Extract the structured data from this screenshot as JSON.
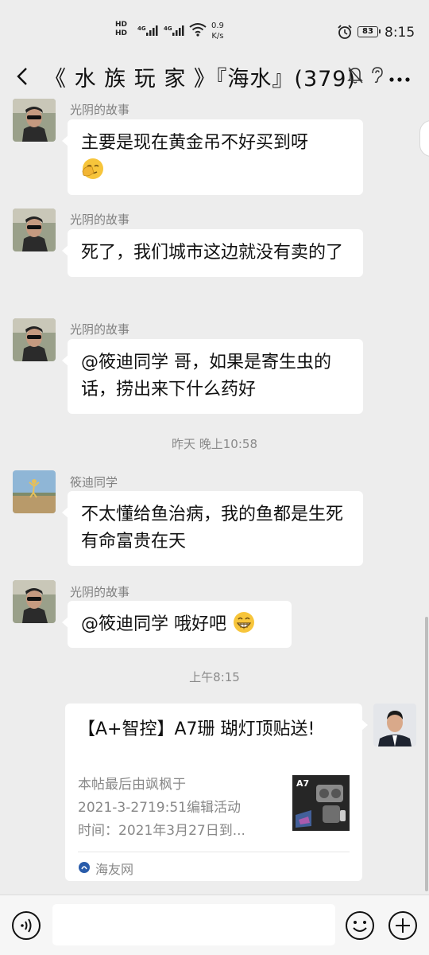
{
  "status_bar": {
    "hd_labels": "HD\nHD",
    "signal1": "4G",
    "signal2": "4G",
    "net_speed": "0.9\nK/s",
    "battery": "83",
    "time": "8:15"
  },
  "header": {
    "title": "《 水 族 玩 家 》『海水』(379)"
  },
  "messages": [
    {
      "sender": "光阴的故事",
      "text": "主要是现在黄金吊不好买到呀",
      "emoji": "facepalm-emoji"
    },
    {
      "sender": "光阴的故事",
      "text": "死了，我们城市这边就没有卖的了"
    },
    {
      "sender": "光阴的故事",
      "text": "@筱迪同学  哥，如果是寄生虫的话，捞出来下什么药好"
    },
    {
      "sender": "筱迪同学",
      "text": "不太懂给鱼治病，我的鱼都是生死有命富贵在天"
    },
    {
      "sender": "光阴的故事",
      "text": "@筱迪同学  哦好吧",
      "emoji": "grin-emoji"
    }
  ],
  "timestamps": {
    "t1": "昨天 晚上10:58",
    "t2": "上午8:15"
  },
  "link_card": {
    "title": "【A+智控】A7珊 瑚灯顶贴送!",
    "desc_lines": [
      "本帖最后由飒枫于",
      "2021-3-2719:51编辑活动",
      "时间：2021年3月27日到..."
    ],
    "thumb_label": "A7",
    "source": "海友网"
  },
  "input": {
    "placeholder": ""
  },
  "colors": {
    "background": "#ededed",
    "bubble": "#ffffff",
    "meta_text": "#808080"
  }
}
